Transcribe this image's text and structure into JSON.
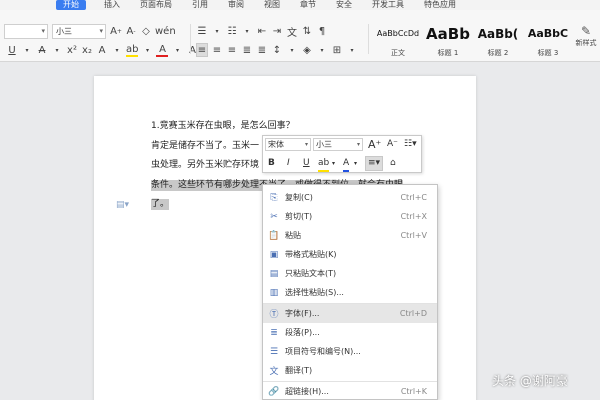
{
  "menu": {
    "tabs": [
      "开始",
      "插入",
      "页面布局",
      "引用",
      "审阅",
      "视图",
      "章节",
      "安全",
      "开发工具",
      "特色应用"
    ]
  },
  "toolbar": {
    "font_size": "小三",
    "font_name_width": "",
    "styles": [
      {
        "sample": "AaBbCcDd",
        "name": "正文"
      },
      {
        "sample": "AaBb",
        "name": "标题 1"
      },
      {
        "sample": "AaBb(",
        "name": "标题 2"
      },
      {
        "sample": "AaBbC",
        "name": "标题 3"
      }
    ],
    "new_style": "新样式"
  },
  "document": {
    "line1": "1.竞赛玉米存在虫眼，是怎么回事？",
    "line2": "肯定是储存不当了。玉米一",
    "line3": "虫处理。另外玉米贮存环境",
    "line4": "条件。这些环节有哪步处理不当了，或做得不到位，就会有虫眼",
    "line5": "了。"
  },
  "mini_toolbar": {
    "font_name": "宋体",
    "font_size": "小三"
  },
  "context_menu": {
    "items": [
      {
        "label": "复制(C)",
        "shortcut": "Ctrl+C"
      },
      {
        "label": "剪切(T)",
        "shortcut": "Ctrl+X"
      },
      {
        "label": "粘贴",
        "shortcut": "Ctrl+V"
      },
      {
        "label": "带格式粘贴(K)",
        "shortcut": ""
      },
      {
        "label": "只粘贴文本(T)",
        "shortcut": ""
      },
      {
        "label": "选择性粘贴(S)...",
        "shortcut": ""
      },
      {
        "label": "字体(F)...",
        "shortcut": "Ctrl+D"
      },
      {
        "label": "段落(P)...",
        "shortcut": ""
      },
      {
        "label": "项目符号和编号(N)...",
        "shortcut": ""
      },
      {
        "label": "翻译(T)",
        "shortcut": ""
      },
      {
        "label": "超链接(H)...",
        "shortcut": "Ctrl+K"
      }
    ]
  },
  "watermark": "头条 @谢阿豪"
}
